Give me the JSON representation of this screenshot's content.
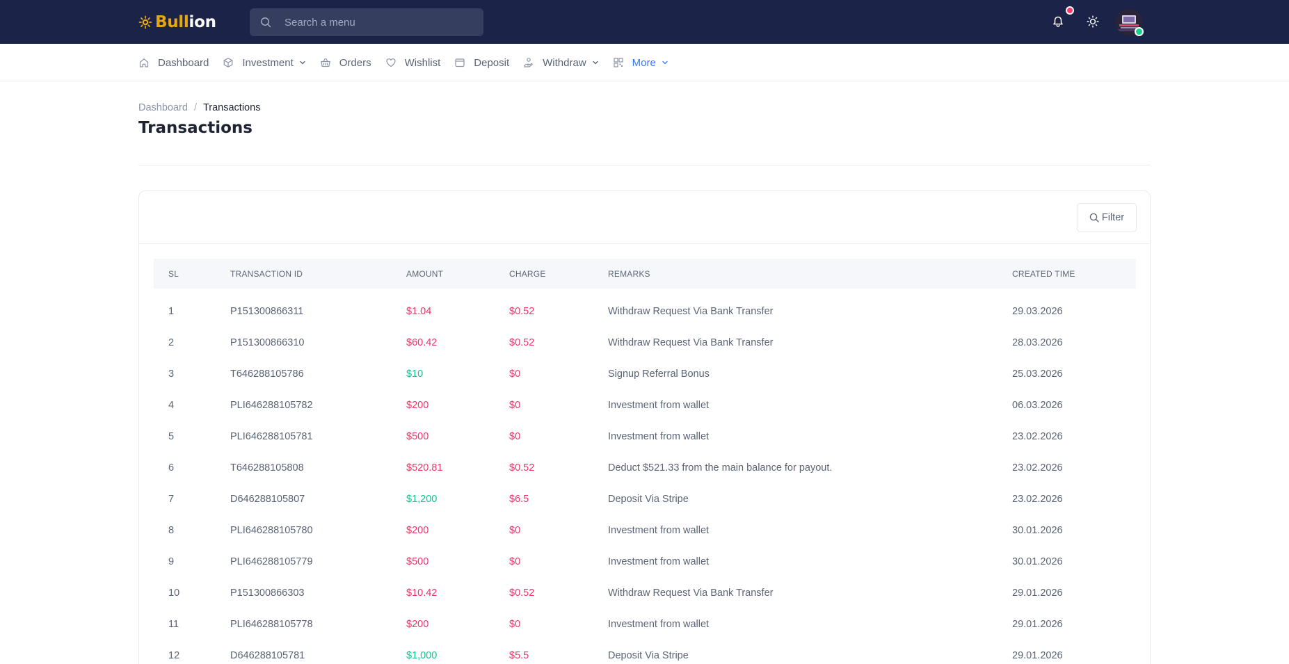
{
  "brand": {
    "name_part1": "Bull",
    "name_part2": "ion",
    "accent": "#e8a614"
  },
  "search": {
    "placeholder": "Search a menu"
  },
  "nav": {
    "items": [
      {
        "label": "Dashboard",
        "icon": "home-icon",
        "has_dropdown": false,
        "active": false
      },
      {
        "label": "Investment",
        "icon": "cube-icon",
        "has_dropdown": true,
        "active": false
      },
      {
        "label": "Orders",
        "icon": "basket-icon",
        "has_dropdown": false,
        "active": false
      },
      {
        "label": "Wishlist",
        "icon": "heart-icon",
        "has_dropdown": false,
        "active": false
      },
      {
        "label": "Deposit",
        "icon": "wallet-icon",
        "has_dropdown": false,
        "active": false
      },
      {
        "label": "Withdraw",
        "icon": "hand-coin-icon",
        "has_dropdown": true,
        "active": false
      },
      {
        "label": "More",
        "icon": "qr-grid-icon",
        "has_dropdown": true,
        "active": true
      }
    ]
  },
  "breadcrumb": {
    "parent": "Dashboard",
    "separator": "/",
    "current": "Transactions"
  },
  "page": {
    "title": "Transactions"
  },
  "filter": {
    "label": "Filter"
  },
  "table": {
    "columns": [
      "SL",
      "TRANSACTION ID",
      "AMOUNT",
      "CHARGE",
      "REMARKS",
      "CREATED TIME"
    ],
    "rows": [
      {
        "sl": "1",
        "id": "P151300866311",
        "amount": "$1.04",
        "amount_type": "neg",
        "charge": "$0.52",
        "remarks": "Withdraw Request Via Bank Transfer",
        "created": "29.03.2026"
      },
      {
        "sl": "2",
        "id": "P151300866310",
        "amount": "$60.42",
        "amount_type": "neg",
        "charge": "$0.52",
        "remarks": "Withdraw Request Via Bank Transfer",
        "created": "28.03.2026"
      },
      {
        "sl": "3",
        "id": "T646288105786",
        "amount": "$10",
        "amount_type": "pos",
        "charge": "$0",
        "remarks": "Signup Referral Bonus",
        "created": "25.03.2026"
      },
      {
        "sl": "4",
        "id": "PLI646288105782",
        "amount": "$200",
        "amount_type": "neg",
        "charge": "$0",
        "remarks": "Investment from wallet",
        "created": "06.03.2026"
      },
      {
        "sl": "5",
        "id": "PLI646288105781",
        "amount": "$500",
        "amount_type": "neg",
        "charge": "$0",
        "remarks": "Investment from wallet",
        "created": "23.02.2026"
      },
      {
        "sl": "6",
        "id": "T646288105808",
        "amount": "$520.81",
        "amount_type": "neg",
        "charge": "$0.52",
        "remarks": "Deduct $521.33 from the main balance for payout.",
        "created": "23.02.2026"
      },
      {
        "sl": "7",
        "id": "D646288105807",
        "amount": "$1,200",
        "amount_type": "pos",
        "charge": "$6.5",
        "remarks": "Deposit Via Stripe",
        "created": "23.02.2026"
      },
      {
        "sl": "8",
        "id": "PLI646288105780",
        "amount": "$200",
        "amount_type": "neg",
        "charge": "$0",
        "remarks": "Investment from wallet",
        "created": "30.01.2026"
      },
      {
        "sl": "9",
        "id": "PLI646288105779",
        "amount": "$500",
        "amount_type": "neg",
        "charge": "$0",
        "remarks": "Investment from wallet",
        "created": "30.01.2026"
      },
      {
        "sl": "10",
        "id": "P151300866303",
        "amount": "$10.42",
        "amount_type": "neg",
        "charge": "$0.52",
        "remarks": "Withdraw Request Via Bank Transfer",
        "created": "29.01.2026"
      },
      {
        "sl": "11",
        "id": "PLI646288105778",
        "amount": "$200",
        "amount_type": "neg",
        "charge": "$0",
        "remarks": "Investment from wallet",
        "created": "29.01.2026"
      },
      {
        "sl": "12",
        "id": "D646288105781",
        "amount": "$1,000",
        "amount_type": "pos",
        "charge": "$5.5",
        "remarks": "Deposit Via Stripe",
        "created": "29.01.2026"
      }
    ]
  },
  "colors": {
    "topbar": "#1b2448",
    "negative": "#f0336b",
    "positive": "#12c391",
    "link_active": "#3478f6",
    "notification": "#ff3a6e",
    "online": "#18d18c"
  }
}
